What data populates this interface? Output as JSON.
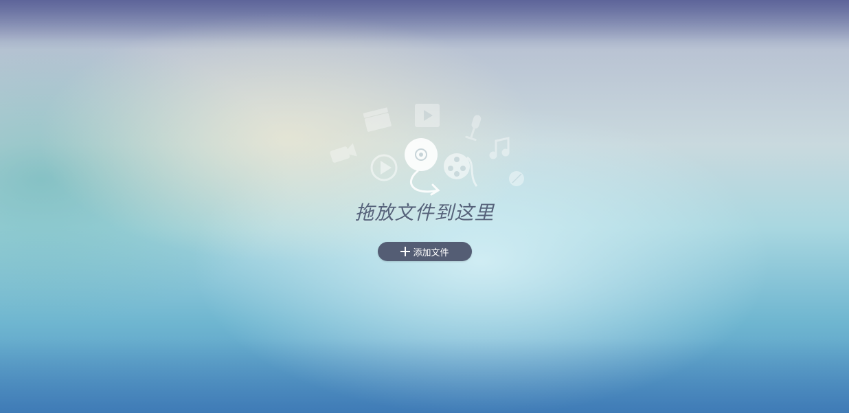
{
  "drop_zone": {
    "title": "拖放文件到这里",
    "add_button_label": "添加文件"
  },
  "icons": [
    "clapperboard-icon",
    "film-strip-icon",
    "microphone-icon",
    "music-note-icon",
    "video-camera-icon",
    "play-circle-icon",
    "disc-icon",
    "film-reel-icon",
    "small-disc-icon",
    "arrow-icon"
  ],
  "colors": {
    "button_bg": "#545d74",
    "title_text": "#55627a",
    "icon_fill": "#ffffff"
  }
}
